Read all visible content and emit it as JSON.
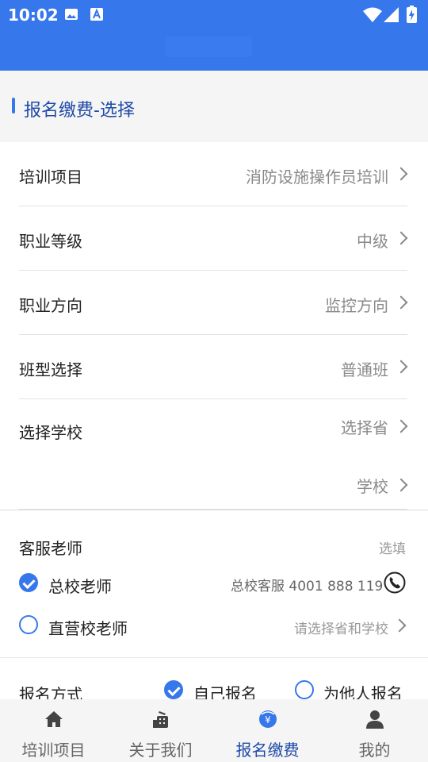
{
  "status_bar": {
    "time": "10:02"
  },
  "section": {
    "title": "报名缴费-选择"
  },
  "form": {
    "rows": [
      {
        "label": "培训项目",
        "value": "消防设施操作员培训"
      },
      {
        "label": "职业等级",
        "value": "中级"
      },
      {
        "label": "职业方向",
        "value": "监控方向"
      },
      {
        "label": "班型选择",
        "value": "普通班"
      },
      {
        "label": "选择学校",
        "value": "选择省"
      }
    ],
    "school_value": "学校"
  },
  "service": {
    "label": "客服老师",
    "optional": "选填",
    "option_main": "总校老师",
    "main_hotline": "总校客服 4001 888 119",
    "option_direct": "直营校老师",
    "direct_hint": "请选择省和学校"
  },
  "signup": {
    "label": "报名方式",
    "self": "自己报名",
    "others": "为他人报名"
  },
  "tabs": [
    {
      "label": "培训项目",
      "icon": "home-icon"
    },
    {
      "label": "关于我们",
      "icon": "about-icon"
    },
    {
      "label": "报名缴费",
      "icon": "payment-icon"
    },
    {
      "label": "我的",
      "icon": "person-icon"
    }
  ],
  "colors": {
    "accent": "#3777ec",
    "title_blue": "#1f4aa8"
  }
}
